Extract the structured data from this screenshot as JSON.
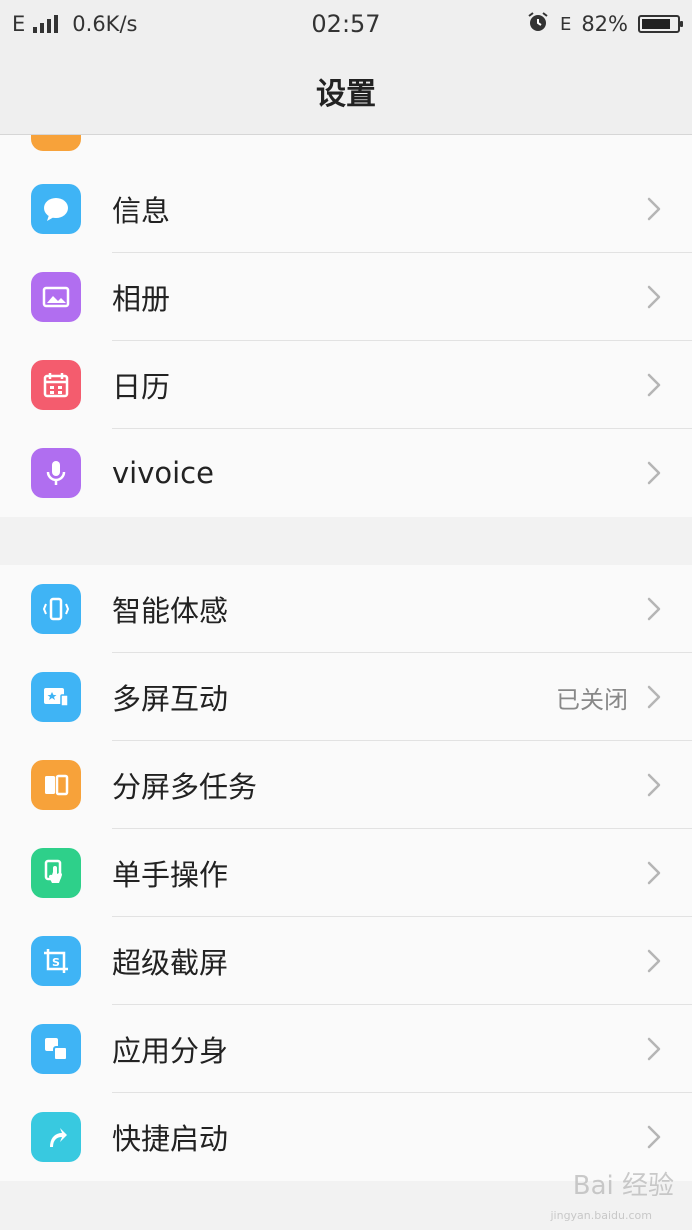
{
  "status_bar": {
    "network": "E",
    "speed": "0.6K/s",
    "time": "02:57",
    "battery": "82%",
    "battery_level": 0.82,
    "data_type": "E"
  },
  "header": {
    "title": "设置"
  },
  "group1": {
    "items": [
      {
        "label": "信息",
        "icon": "message-icon",
        "color": "#3fb4f5"
      },
      {
        "label": "相册",
        "icon": "gallery-icon",
        "color": "#b16ef0"
      },
      {
        "label": "日历",
        "icon": "calendar-icon",
        "color": "#f45c6e"
      },
      {
        "label": "vivoice",
        "icon": "microphone-icon",
        "color": "#b06ef0"
      }
    ]
  },
  "group2": {
    "items": [
      {
        "label": "智能体感",
        "icon": "phone-motion-icon",
        "color": "#3fb4f5",
        "value": ""
      },
      {
        "label": "多屏互动",
        "icon": "multiscreen-icon",
        "color": "#3fb4f5",
        "value": "已关闭"
      },
      {
        "label": "分屏多任务",
        "icon": "split-screen-icon",
        "color": "#f7a23a",
        "value": ""
      },
      {
        "label": "单手操作",
        "icon": "one-hand-icon",
        "color": "#2ed08a",
        "value": ""
      },
      {
        "label": "超级截屏",
        "icon": "screenshot-icon",
        "color": "#3fb4f5",
        "value": ""
      },
      {
        "label": "应用分身",
        "icon": "app-clone-icon",
        "color": "#3fb4f5",
        "value": ""
      },
      {
        "label": "快捷启动",
        "icon": "quick-launch-icon",
        "color": "#38c9e0",
        "value": ""
      }
    ]
  },
  "watermark": {
    "text": "Bai 经验",
    "sub": "jingyan.baidu.com"
  }
}
